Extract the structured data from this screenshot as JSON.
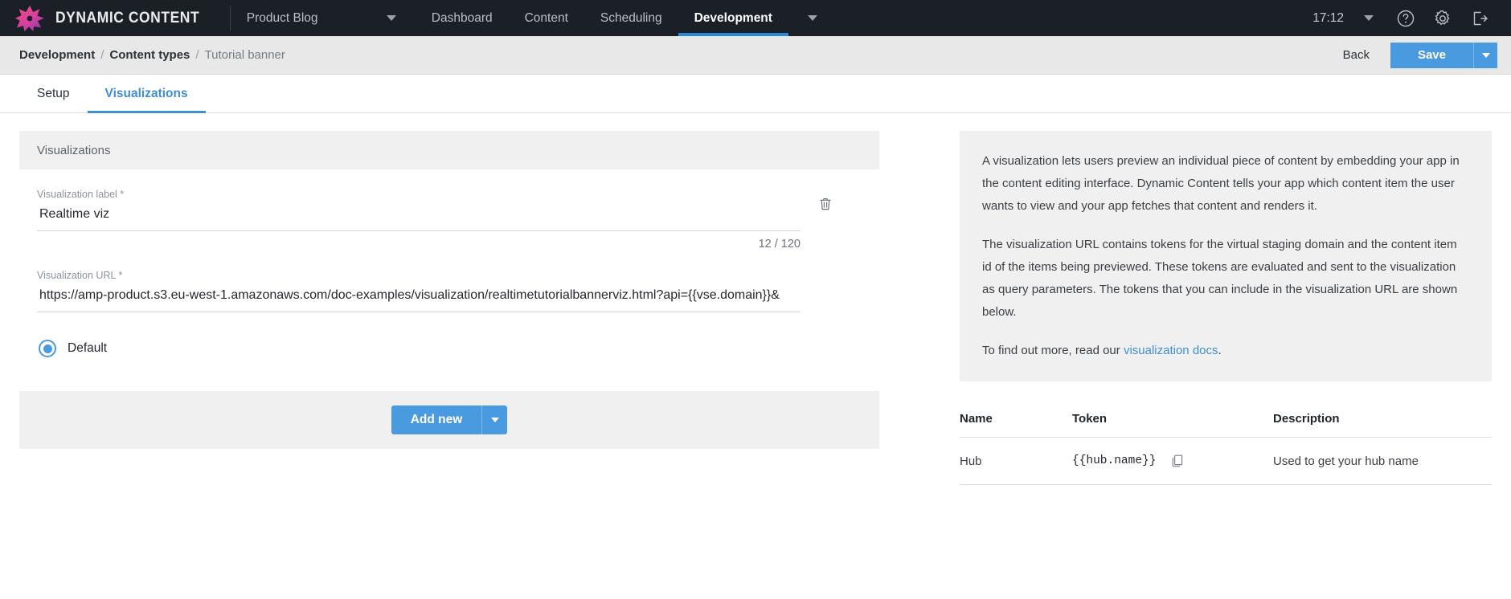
{
  "topnav": {
    "brand": "DYNAMIC CONTENT",
    "site_selector": "Product Blog",
    "items": [
      {
        "label": "Dashboard",
        "active": false
      },
      {
        "label": "Content",
        "active": false
      },
      {
        "label": "Scheduling",
        "active": false
      },
      {
        "label": "Development",
        "active": true
      }
    ],
    "clock": "17:12",
    "icons": {
      "help": "help-circle-icon",
      "settings": "gear-icon",
      "logout": "logout-icon",
      "site_caret": "chevron-down-icon",
      "section_caret": "chevron-down-icon",
      "clock_caret": "chevron-down-icon"
    }
  },
  "breadcrumb": {
    "items": [
      "Development",
      "Content types",
      "Tutorial banner"
    ],
    "separator": "/"
  },
  "actions": {
    "back_label": "Back",
    "save_label": "Save",
    "save_caret": "chevron-down-icon"
  },
  "tabs": [
    {
      "label": "Setup",
      "active": false
    },
    {
      "label": "Visualizations",
      "active": true
    }
  ],
  "panel": {
    "title": "Visualizations",
    "label_field": {
      "label": "Visualization label *",
      "value": "Realtime viz",
      "counter": "12 / 120"
    },
    "url_field": {
      "label": "Visualization URL *",
      "value": "https://amp-product.s3.eu-west-1.amazonaws.com/doc-examples/visualization/realtimetutorialbannerviz.html?api={{vse.domain}}&"
    },
    "default_radio": {
      "label": "Default",
      "selected": true
    },
    "delete_icon": "trash-icon",
    "footer": {
      "add_new_label": "Add new",
      "add_new_caret": "chevron-down-icon"
    }
  },
  "help": {
    "paragraphs": [
      "A visualization lets users preview an individual piece of content by embedding your app in the content editing interface. Dynamic Content tells your app which content item the user wants to view and your app fetches that content and renders it.",
      "The visualization URL contains tokens for the virtual staging domain and the content item id of the items being previewed. These tokens are evaluated and sent to the visualization as query parameters. The tokens that you can include in the visualization URL are shown below."
    ],
    "footer_prefix": "To find out more, read our ",
    "footer_link": "visualization docs",
    "footer_suffix": "."
  },
  "token_table": {
    "columns": [
      "Name",
      "Token",
      "Description"
    ],
    "rows": [
      {
        "name": "Hub",
        "token": "{{hub.name}}",
        "description": "Used to get your hub name",
        "copy_icon": "copy-icon"
      }
    ]
  },
  "colors": {
    "nav_bg": "#1b2027",
    "accent_blue": "#4a9ae0",
    "tab_blue": "#3f8fd2",
    "bar_bg": "#e8e8e8",
    "panel_bg": "#f0f0f0"
  }
}
